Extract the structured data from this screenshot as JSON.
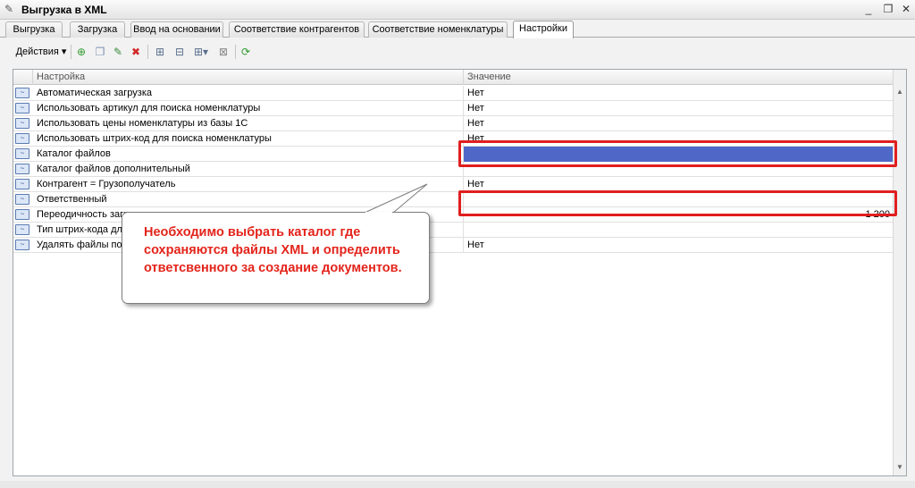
{
  "window": {
    "title": "Выгрузка  в XML",
    "app_icon": "document-icon",
    "controls": {
      "minimize": "_",
      "restore": "❐",
      "close": "✕"
    }
  },
  "tabs": [
    {
      "label": "Выгрузка",
      "active": false
    },
    {
      "label": "Загрузка",
      "active": false
    },
    {
      "label": "Ввод на основании",
      "active": false
    },
    {
      "label": "Соответствие контрагентов",
      "active": false
    },
    {
      "label": "Соответствие номенклатуры",
      "active": false
    },
    {
      "label": "Настройки",
      "active": true
    }
  ],
  "toolbar": {
    "actions_label": "Действия ▾",
    "buttons": [
      "add-icon",
      "copy-icon",
      "edit-icon",
      "delete-icon",
      "filter-icon",
      "filter-list-icon",
      "filter-dropdown-icon",
      "filter-clear-icon",
      "refresh-icon"
    ]
  },
  "grid": {
    "columns": {
      "name": "Настройка",
      "value": "Значение"
    },
    "rows": [
      {
        "name": "Автоматическая загрузка",
        "value": "Нет"
      },
      {
        "name": "Использовать артикул для поиска номенклатуры",
        "value": "Нет"
      },
      {
        "name": "Использовать цены номенклатуры из базы 1С",
        "value": "Нет"
      },
      {
        "name": "Использовать штрих-код для поиска номенклатуры",
        "value": "Нет"
      },
      {
        "name": "Каталог файлов",
        "value": ""
      },
      {
        "name": "Каталог файлов дополнительный",
        "value": ""
      },
      {
        "name": "Контрагент = Грузополучатель",
        "value": "Нет"
      },
      {
        "name": "Ответственный",
        "value": ""
      },
      {
        "name": "Переодичность загр",
        "value": "1 200"
      },
      {
        "name": "Тип штрих-кода для",
        "value": ""
      },
      {
        "name": "Удалять файлы посл",
        "value": "Нет"
      }
    ]
  },
  "callout": {
    "text": "Необходимо выбрать каталог где сохраняются файлы XML и определить ответсвенного за создание документов."
  },
  "colors": {
    "highlight": "#e01e1e",
    "selection": "#4f67c6",
    "callout_text": "#e3241b"
  }
}
